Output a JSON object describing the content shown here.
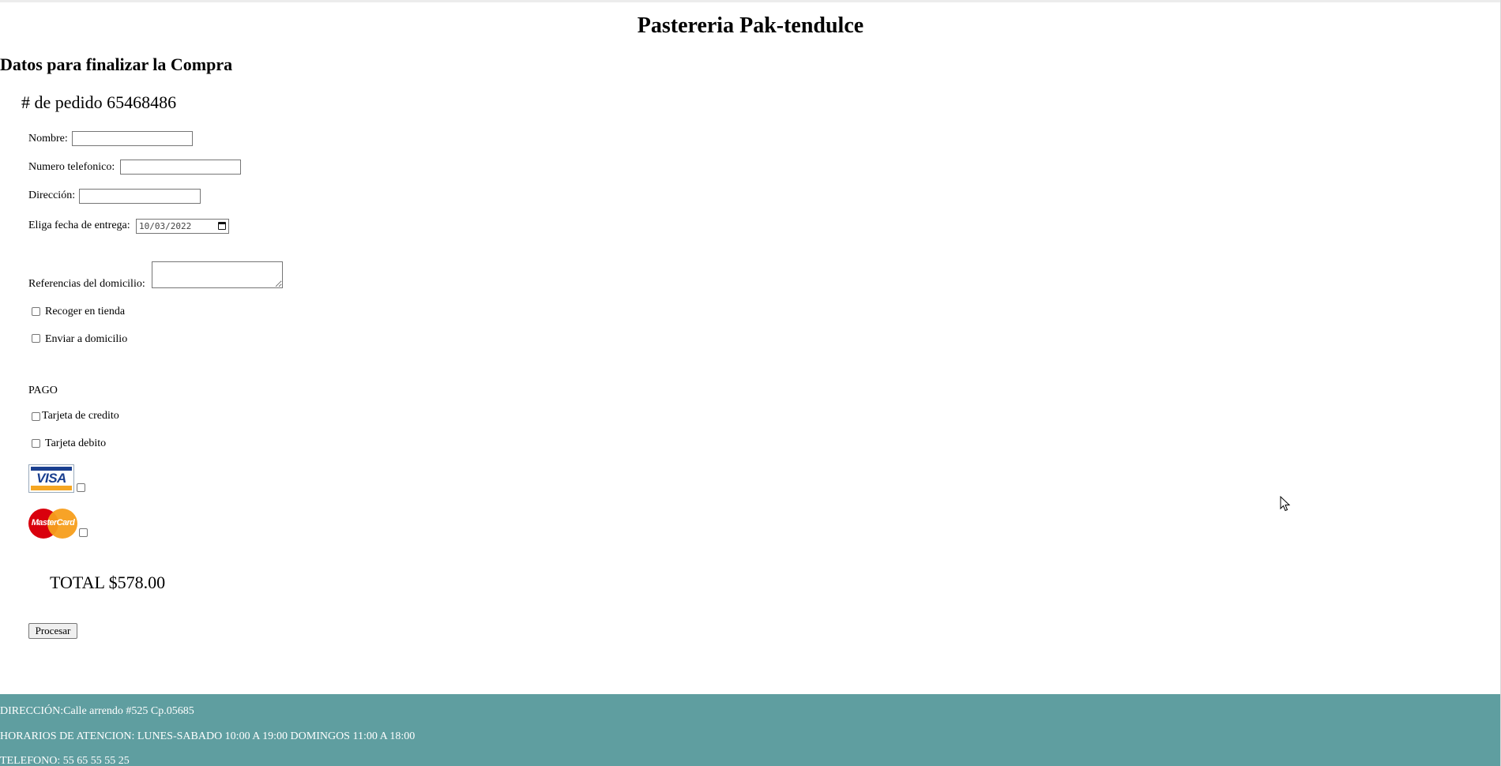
{
  "header": {
    "site_title": "Pastereria Pak-tendulce"
  },
  "main": {
    "section_title": "Datos para finalizar la Compra",
    "order_number": "# de pedido 65468486",
    "form": {
      "name_label": "Nombre:",
      "name_value": "",
      "phone_label": "Numero telefonico:",
      "phone_value": "",
      "address_label": "Dirección:",
      "address_value": "",
      "date_label": "Eliga fecha de entrega:",
      "date_value": "10/03/2022",
      "references_label": "Referencias del domicilio:",
      "references_value": "",
      "pickup_label": "Recoger en tienda",
      "pickup_checked": false,
      "delivery_label": "Enviar a domicilio",
      "delivery_checked": false
    },
    "payment": {
      "heading": "PAGO",
      "credit_label": "Tarjeta de credito",
      "credit_checked": false,
      "debit_label": "Tarjeta debito",
      "debit_checked": false,
      "visa_logo_text": "VISA",
      "visa_checked": false,
      "mastercard_logo_text": "MasterCard",
      "mastercard_checked": false
    },
    "total": "TOTAL $578.00",
    "submit_label": "Procesar"
  },
  "footer": {
    "address": "DIRECCIÓN:Calle arrendo #525 Cp.05685",
    "hours": "HORARIOS DE ATENCION: LUNES-SABADO 10:00 A 19:00 DOMINGOS 11:00 A 18:00",
    "phone": "TELEFONO: 55 65 55 55 25"
  },
  "colors": {
    "footer_bg": "#5f9ea0",
    "footer_text": "#ffffff",
    "visa_blue": "#1a3f8f",
    "visa_gold": "#f5a623",
    "mastercard_red": "#d9000d",
    "mastercard_orange": "#f79e1b"
  }
}
